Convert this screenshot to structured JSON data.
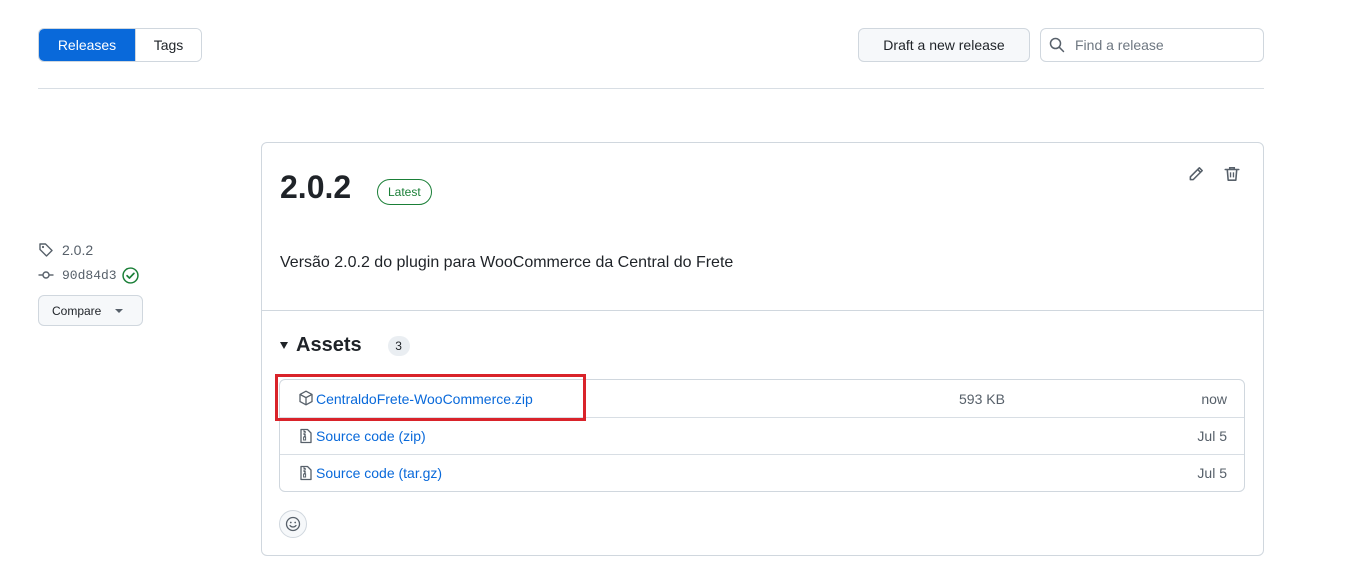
{
  "tabs": [
    {
      "label": "Releases",
      "active": true
    },
    {
      "label": "Tags",
      "active": false
    }
  ],
  "toolbar": {
    "draft_label": "Draft a new release",
    "search_placeholder": "Find a release"
  },
  "sidebar": {
    "tag": "2.0.2",
    "commit": "90d84d3",
    "compare_label": "Compare"
  },
  "release": {
    "title": "2.0.2",
    "badge": "Latest",
    "description": "Versão 2.0.2 do plugin para WooCommerce da Central do Frete"
  },
  "assets": {
    "heading": "Assets",
    "count": "3",
    "items": [
      {
        "name": "CentraldoFrete-WooCommerce.zip",
        "suffix": "",
        "size": "593 KB",
        "date": "now",
        "icon": "package-icon"
      },
      {
        "name": "Source code",
        "suffix": "(zip)",
        "size": "",
        "date": "Jul 5",
        "icon": "file-zip-icon"
      },
      {
        "name": "Source code",
        "suffix": "(tar.gz)",
        "size": "",
        "date": "Jul 5",
        "icon": "file-zip-icon"
      }
    ]
  },
  "colors": {
    "accent": "#0969da",
    "success": "#1a7f37",
    "highlight": "#d9232a"
  }
}
